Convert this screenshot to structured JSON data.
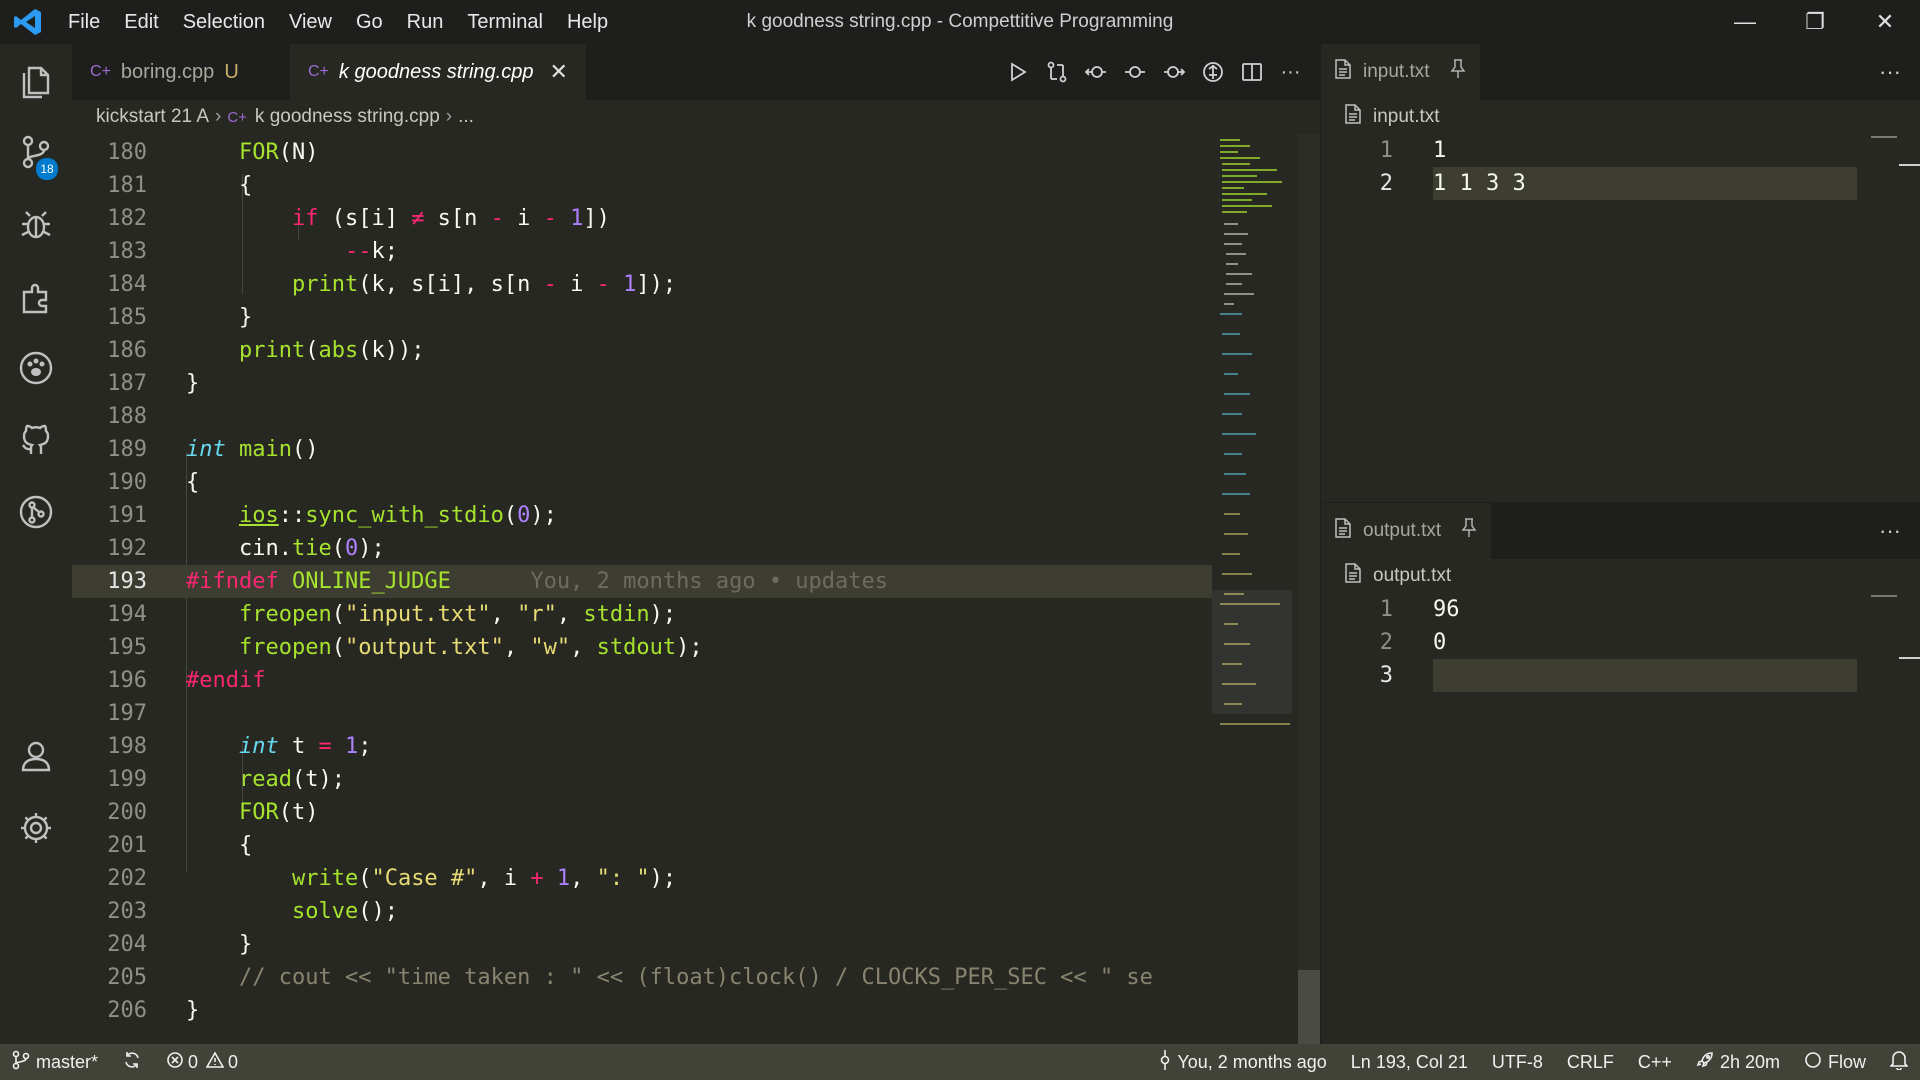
{
  "window": {
    "title": "k goodness string.cpp - Compettitive Programming",
    "menu": [
      "File",
      "Edit",
      "Selection",
      "View",
      "Go",
      "Run",
      "Terminal",
      "Help"
    ],
    "controls": {
      "minimize": "—",
      "restore": "❐",
      "close": "✕"
    }
  },
  "activity": {
    "scm_badge": "18",
    "icons": [
      "explorer-icon",
      "source-control-icon",
      "debug-icon",
      "extensions-icon",
      "paw-icon",
      "github-icon",
      "git-graph-icon",
      "account-icon",
      "settings-icon"
    ]
  },
  "editor": {
    "tabs": [
      {
        "label": "boring.cpp",
        "status": "U",
        "icon": "C+",
        "active": false
      },
      {
        "label": "k goodness string.cpp",
        "icon": "C+",
        "close": "✕",
        "active": true
      }
    ],
    "toolbar": [
      "run-icon",
      "compare-icon",
      "go-back-icon",
      "timeline-prev-icon",
      "timeline-next-icon",
      "open-changes-icon",
      "split-editor-icon",
      "more-icon"
    ],
    "toolbar_more": "···",
    "breadcrumb": {
      "folder": "kickstart 21 A",
      "file": "k goodness string.cpp",
      "tail": "...",
      "icon": "C+"
    },
    "current_line": 193,
    "blame": "You, 2 months ago • updates"
  },
  "input_panel": {
    "tab": "input.txt",
    "crumb": "input.txt",
    "lines": [
      "1",
      "1 1 3 3"
    ],
    "more": "···"
  },
  "output_panel": {
    "tab": "output.txt",
    "crumb": "output.txt",
    "lines": [
      "96",
      "0",
      ""
    ],
    "more": "···"
  },
  "status": {
    "branch": "master*",
    "errors": "0",
    "warnings": "0",
    "blame": "You, 2 months ago",
    "position": "Ln 193, Col 21",
    "encoding": "UTF-8",
    "eol": "CRLF",
    "language": "C++",
    "timer": "2h 20m",
    "flow": "Flow"
  }
}
